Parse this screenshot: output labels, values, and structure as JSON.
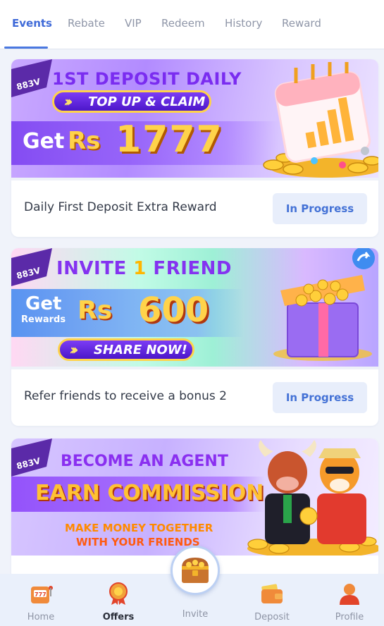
{
  "tabs": [
    {
      "label": "Events",
      "active": true
    },
    {
      "label": "Rebate",
      "active": false
    },
    {
      "label": "VIP",
      "active": false
    },
    {
      "label": "Redeem",
      "active": false
    },
    {
      "label": "History",
      "active": false
    },
    {
      "label": "Reward",
      "active": false
    }
  ],
  "brand_badge": "883V",
  "cards": [
    {
      "banner": {
        "headline": "1ST DEPOSIT DAILY",
        "button": "TOP UP & CLAIM",
        "get": "Get",
        "currency": "Rs",
        "amount": "1777"
      },
      "title": "Daily First Deposit Extra Reward",
      "status": "In Progress"
    },
    {
      "banner": {
        "headline_prefix": "INVITE ",
        "headline_number": "1",
        "headline_suffix": " FRIEND",
        "get": "Get",
        "rewards": "Rewards",
        "currency": "Rs",
        "amount": "600",
        "button": "SHARE NOW!"
      },
      "title": "Refer friends to receive a bonus 2",
      "status": "In Progress"
    },
    {
      "banner": {
        "headline": "BECOME AN AGENT",
        "subhead": "EARN COMMISSION",
        "line1": "MAKE MONEY TOGETHER",
        "line2": "WITH YOUR FRIENDS"
      }
    }
  ],
  "bottom_nav": [
    {
      "label": "Home",
      "icon": "slot-machine-icon",
      "active": false
    },
    {
      "label": "Offers",
      "icon": "medal-icon",
      "active": true
    },
    {
      "label": "Invite",
      "icon": "treasure-chest-icon",
      "active": false
    },
    {
      "label": "Deposit",
      "icon": "wallet-icon",
      "active": false
    },
    {
      "label": "Profile",
      "icon": "user-icon",
      "active": false
    }
  ],
  "colors": {
    "accent": "#3f6ad8",
    "status_bg": "#e8eefb",
    "background": "#f0f3fa"
  }
}
